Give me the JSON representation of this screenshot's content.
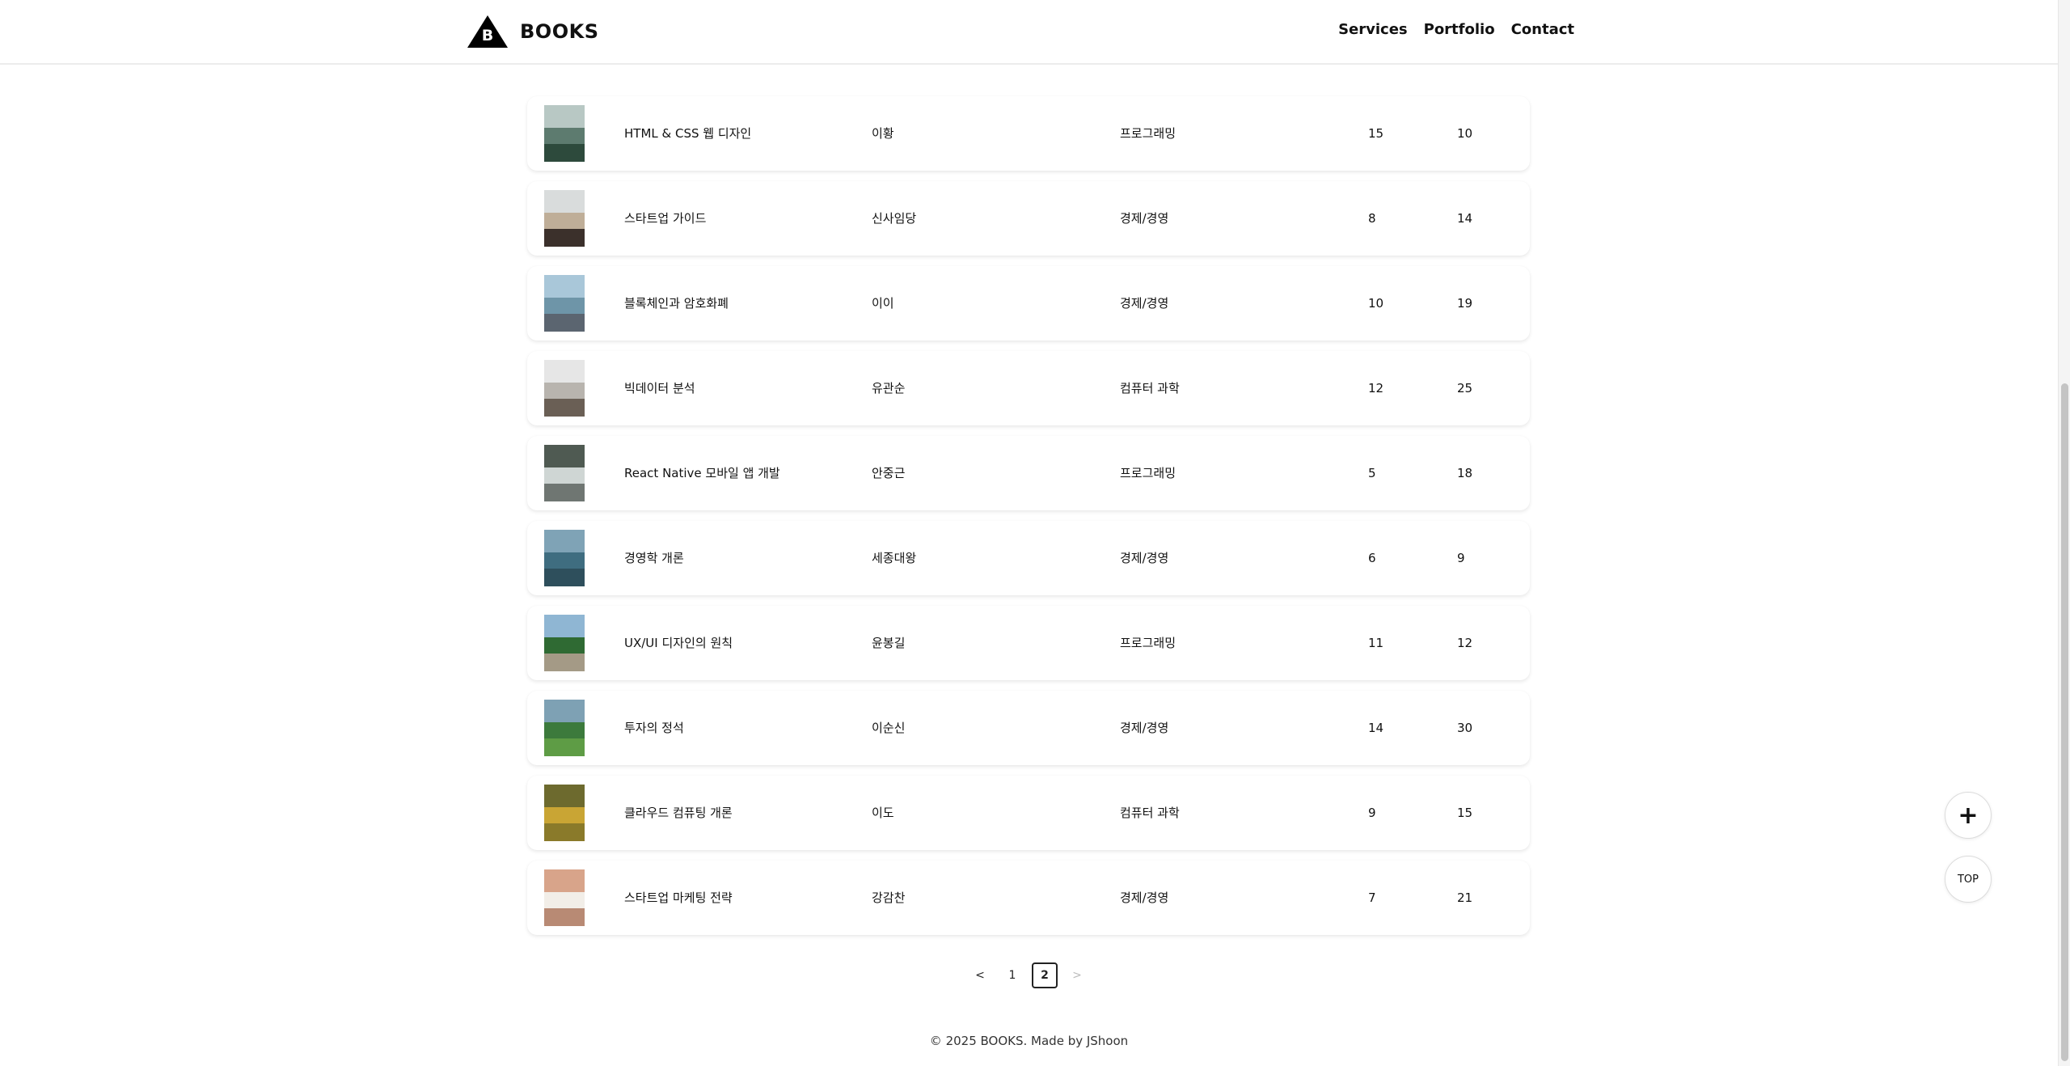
{
  "header": {
    "logo_letter": "B",
    "brand": "BOOKS",
    "nav": [
      "Services",
      "Portfolio",
      "Contact"
    ]
  },
  "books": [
    {
      "title": "HTML & CSS 웹 디자인",
      "author": "이황",
      "category": "프로그래밍",
      "qty": "15",
      "count": "10",
      "cover": "cover-misty-shore",
      "palette": [
        "#b8c8c4",
        "#5d7b6f",
        "#2d4a3c"
      ]
    },
    {
      "title": "스타트업 가이드",
      "author": "신사임당",
      "category": "경제/경영",
      "qty": "8",
      "count": "14",
      "cover": "cover-rocky-beach",
      "palette": [
        "#d9dcdc",
        "#bfae98",
        "#3b302b"
      ]
    },
    {
      "title": "블록체인과 암호화폐",
      "author": "이이",
      "category": "경제/경영",
      "qty": "10",
      "count": "19",
      "cover": "cover-blue-coast",
      "palette": [
        "#a9c7d9",
        "#6e95a8",
        "#5b6570"
      ]
    },
    {
      "title": "빅데이터 분석",
      "author": "유관순",
      "category": "컴퓨터 과학",
      "qty": "12",
      "count": "25",
      "cover": "cover-grey-rocks",
      "palette": [
        "#e6e6e6",
        "#b8b4ae",
        "#6a5f55"
      ]
    },
    {
      "title": "React Native 모바일 앱 개발",
      "author": "안중근",
      "category": "프로그래밍",
      "qty": "5",
      "count": "18",
      "cover": "cover-waterfall",
      "palette": [
        "#4f5a52",
        "#cfd6d4",
        "#6f7672"
      ]
    },
    {
      "title": "경영학 개론",
      "author": "세종대왕",
      "category": "경제/경영",
      "qty": "6",
      "count": "9",
      "cover": "cover-lake",
      "palette": [
        "#7fa3b6",
        "#3f6d80",
        "#2e4f5c"
      ]
    },
    {
      "title": "UX/UI 디자인의 원칙",
      "author": "윤봉길",
      "category": "프로그래밍",
      "qty": "11",
      "count": "12",
      "cover": "cover-forest-path",
      "palette": [
        "#8fb6d3",
        "#2f6a33",
        "#a49a86"
      ]
    },
    {
      "title": "투자의 정석",
      "author": "이순신",
      "category": "경제/경영",
      "qty": "14",
      "count": "30",
      "cover": "cover-grass-field",
      "palette": [
        "#7ea1b4",
        "#3c7a3c",
        "#5e9c45"
      ]
    },
    {
      "title": "클라우드 컴퓨팅 개론",
      "author": "이도",
      "category": "컴퓨터 과학",
      "qty": "9",
      "count": "15",
      "cover": "cover-yellow-tree",
      "palette": [
        "#6d6a2e",
        "#c9a534",
        "#8a7a2a"
      ]
    },
    {
      "title": "스타트업 마케팅 전략",
      "author": "강감찬",
      "category": "경제/경영",
      "qty": "7",
      "count": "21",
      "cover": "cover-interior",
      "palette": [
        "#d8a48a",
        "#f2eee8",
        "#b88a74"
      ]
    }
  ],
  "pagination": {
    "prev": "<",
    "pages": [
      "1",
      "2"
    ],
    "current": "2",
    "next": ">"
  },
  "footer": "© 2025 BOOKS. Made by JShoon",
  "floating": {
    "add": "+",
    "top": "TOP"
  }
}
